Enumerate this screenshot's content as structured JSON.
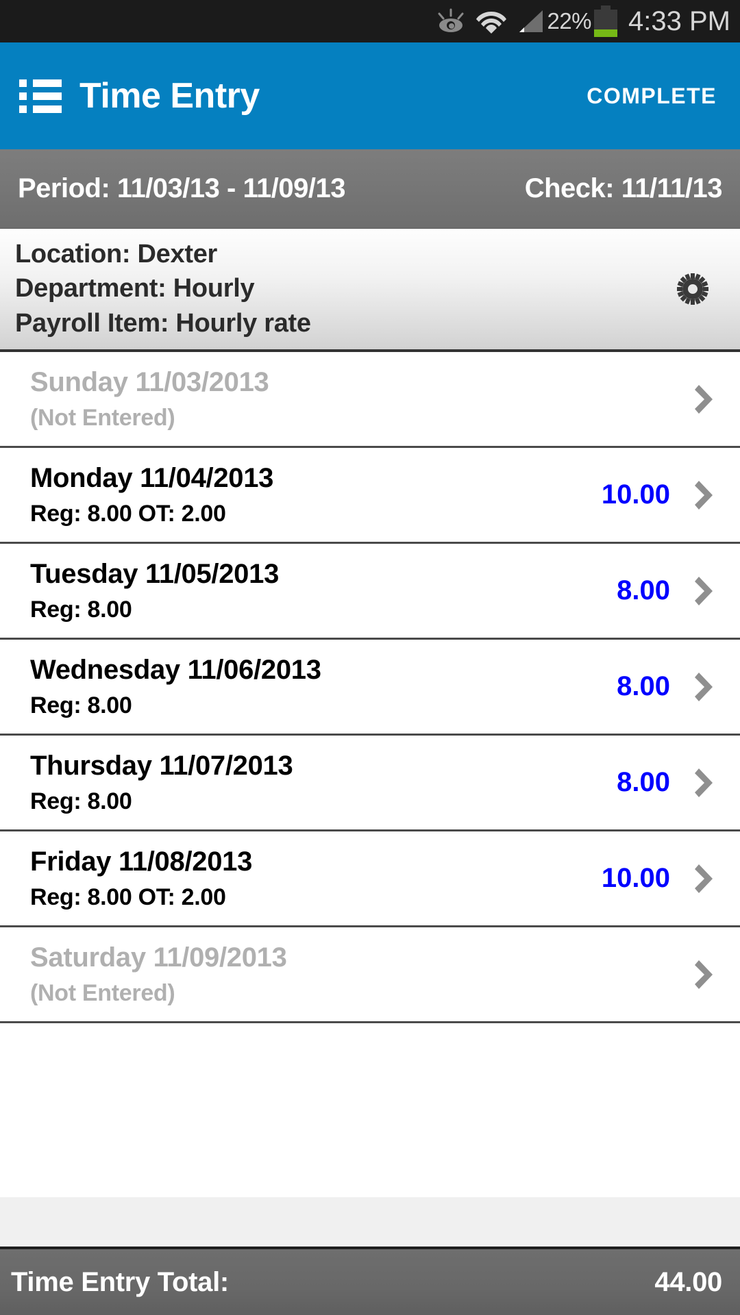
{
  "status_bar": {
    "icons": [
      "smart-stay-eye-icon",
      "wifi-icon",
      "cell-signal-icon",
      "battery-icon"
    ],
    "battery_percent": "22%",
    "time": "4:33 PM"
  },
  "action_bar": {
    "menu_icon": "list-menu-icon",
    "title": "Time Entry",
    "complete_label": "COMPLETE",
    "accent_color": "#0580c0"
  },
  "period_bar": {
    "period": "Period: 11/03/13 - 11/09/13",
    "check": "Check: 11/11/13"
  },
  "info_panel": {
    "location": "Location: Dexter",
    "department": "Department: Hourly",
    "payroll_item": "Payroll Item: Hourly rate",
    "settings_icon": "gear-icon"
  },
  "days": [
    {
      "title": "Sunday 11/03/2013",
      "sub": "(Not Entered)",
      "amount": "",
      "entered": false
    },
    {
      "title": "Monday 11/04/2013",
      "sub": "Reg: 8.00 OT: 2.00",
      "amount": "10.00",
      "entered": true
    },
    {
      "title": "Tuesday 11/05/2013",
      "sub": "Reg: 8.00",
      "amount": "8.00",
      "entered": true
    },
    {
      "title": "Wednesday 11/06/2013",
      "sub": "Reg: 8.00",
      "amount": "8.00",
      "entered": true
    },
    {
      "title": "Thursday 11/07/2013",
      "sub": "Reg: 8.00",
      "amount": "8.00",
      "entered": true
    },
    {
      "title": "Friday 11/08/2013",
      "sub": "Reg: 8.00 OT: 2.00",
      "amount": "10.00",
      "entered": true
    },
    {
      "title": "Saturday 11/09/2013",
      "sub": "(Not Entered)",
      "amount": "",
      "entered": false
    }
  ],
  "total_bar": {
    "label": "Time Entry Total:",
    "value": "44.00"
  },
  "colors": {
    "accent_blue": "#0580c0",
    "amount_blue": "#0000ff",
    "disabled_gray": "#b0b0b0",
    "battery_green": "#76b916"
  }
}
